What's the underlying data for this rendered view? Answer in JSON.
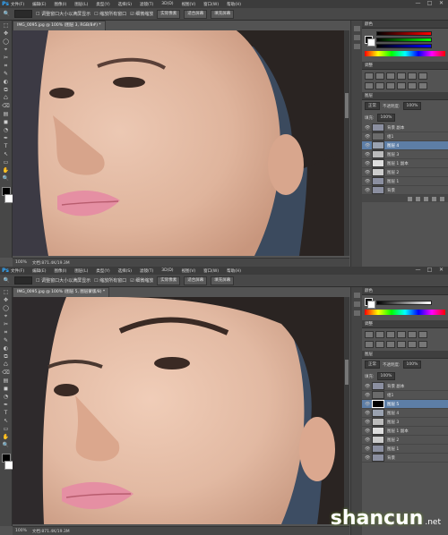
{
  "app": {
    "logo": "Ps"
  },
  "menu": [
    "文件(F)",
    "编辑(E)",
    "图像(I)",
    "图层(L)",
    "类型(Y)",
    "选择(S)",
    "滤镜(T)",
    "3D(D)",
    "视图(V)",
    "窗口(W)",
    "帮助(H)"
  ],
  "window_controls": [
    "—",
    "□",
    "✕"
  ],
  "options_bar": {
    "buttons": [
      "调整窗口大小以满屏显示",
      "缩放所有窗口",
      "细微缩放",
      "实际像素",
      "适合屏幕",
      "填充屏幕"
    ]
  },
  "tools": [
    "⬚",
    "✥",
    "◯",
    "⌖",
    "✂",
    "⌗",
    "✎",
    "◐",
    "⧉",
    "♺",
    "⌫",
    "▤",
    "◼",
    "◔",
    "✒",
    "T",
    "↖",
    "▭",
    "✋",
    "🔍"
  ],
  "top": {
    "doc_tab": "IMG_0095.jpg @ 100% (图层 3, RGB/8#) *",
    "status": [
      "100%",
      "文档:871.4K/19.3M"
    ],
    "layers": [
      {
        "name": "背景 副本",
        "sel": false
      },
      {
        "name": "组1",
        "sel": false
      },
      {
        "name": "图层 4",
        "sel": true
      },
      {
        "name": "图层 3",
        "sel": false
      },
      {
        "name": "图层 1 副本",
        "sel": false
      },
      {
        "name": "图层 2",
        "sel": false
      },
      {
        "name": "图层 1",
        "sel": false
      },
      {
        "name": "背景",
        "sel": false
      }
    ]
  },
  "bottom": {
    "doc_tab": "IMG_0095.jpg @ 100% (图层 5, 图层蒙版/8) *",
    "status": [
      "100%",
      "文档:871.4K/19.3M"
    ],
    "layers": [
      {
        "name": "背景 副本",
        "sel": false
      },
      {
        "name": "组1",
        "sel": false
      },
      {
        "name": "图层 5",
        "sel": true
      },
      {
        "name": "图层 4",
        "sel": false
      },
      {
        "name": "图层 3",
        "sel": false
      },
      {
        "name": "图层 1 副本",
        "sel": false
      },
      {
        "name": "图层 2",
        "sel": false
      },
      {
        "name": "图层 1",
        "sel": false
      },
      {
        "name": "背景",
        "sel": false
      }
    ]
  },
  "panel_tabs": {
    "color": "颜色",
    "adjust": "调整",
    "layers": "图层"
  },
  "blend": {
    "mode": "正常",
    "opacity_label": "不透明度:",
    "opacity": "100%",
    "fill_label": "填充:",
    "fill": "100%"
  },
  "watermark": {
    "text": "shancun",
    "sub": ".net"
  },
  "colors": {
    "skin": "#e2b9a2",
    "hair": "#2b2523",
    "lips": "#e58fa3",
    "selected": "#5d7ea6"
  }
}
